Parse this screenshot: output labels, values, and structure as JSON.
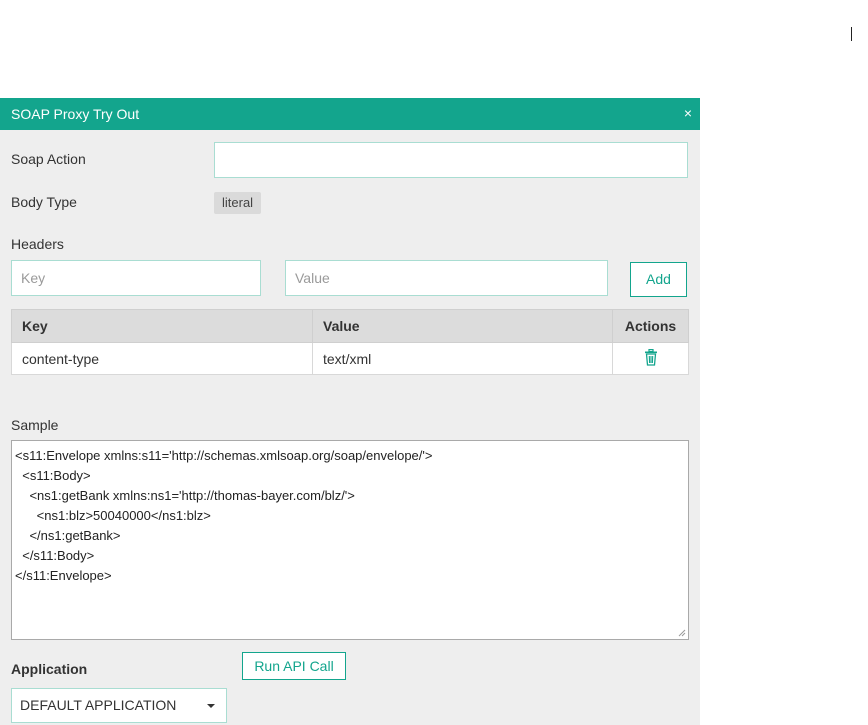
{
  "dialog": {
    "title": "SOAP Proxy Try Out",
    "close_glyph": "×"
  },
  "soap_action": {
    "label": "Soap Action",
    "value": "",
    "placeholder": ""
  },
  "body_type": {
    "label": "Body Type",
    "value": "literal"
  },
  "headers": {
    "label": "Headers",
    "key_placeholder": "Key",
    "value_placeholder": "Value",
    "add_label": "Add",
    "columns": [
      "Key",
      "Value",
      "Actions"
    ],
    "rows": [
      {
        "key": "content-type",
        "value": "text/xml",
        "action_icon": "trash-icon"
      }
    ]
  },
  "sample": {
    "label": "Sample",
    "lines": [
      "<s11:Envelope xmlns:s11='http://schemas.xmlsoap.org/soap/envelope/'>",
      "  <s11:Body>",
      "    <ns1:getBank xmlns:ns1='http://thomas-bayer.com/blz/'>",
      "      <ns1:blz>50040000</ns1:blz>",
      "    </ns1:getBank>",
      "  </s11:Body>",
      "</s11:Envelope>"
    ]
  },
  "run_label": "Run API Call",
  "application": {
    "label": "Application",
    "selected": "DEFAULT APPLICATION"
  },
  "colors": {
    "accent": "#13a58d",
    "panel": "#eeeeee"
  }
}
